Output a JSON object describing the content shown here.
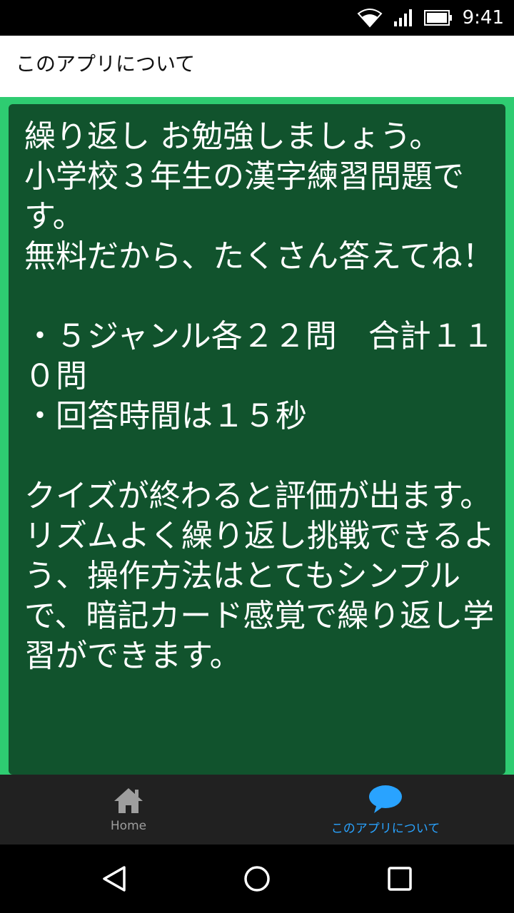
{
  "status_bar": {
    "time": "9:41"
  },
  "appbar": {
    "title": "このアプリについて"
  },
  "content": {
    "text": "繰り返し お勉強しましょう。\n小学校３年生の漢字練習問題です。\n無料だから、たくさん答えてね！\n\n・５ジャンル各２２問　合計１１０問\n・回答時間は１５秒\n\nクイズが終わると評価が出ます。\nリズムよく繰り返し挑戦できるよう、操作方法はとてもシンプルで、暗記カード感覚で繰り返し学習ができます。"
  },
  "bottom_nav": {
    "items": [
      {
        "label": "Home",
        "icon": "home-icon",
        "active": false
      },
      {
        "label": "このアプリについて",
        "icon": "chat-bubble-icon",
        "active": true
      }
    ]
  },
  "colors": {
    "background": "#2ecc71",
    "card": "#11532d",
    "nav_active": "#29a3ff",
    "nav_inactive": "#9e9e9e"
  }
}
